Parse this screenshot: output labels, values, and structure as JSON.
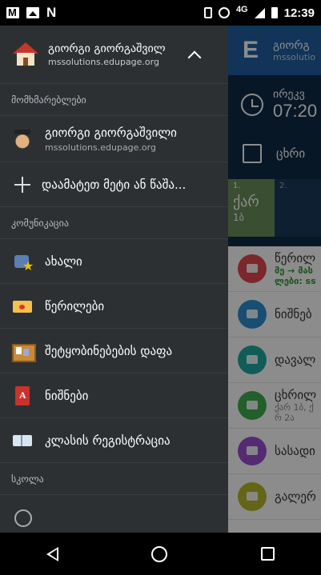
{
  "status_bar": {
    "network": "4G",
    "time": "12:39"
  },
  "background_app": {
    "header": {
      "logo": "E",
      "user_name": "გიორგ",
      "user_school": "mssolutio"
    },
    "time_label": "ირეკვ",
    "time_value": "07:20",
    "schedule_label": "ცხრი",
    "lessons": [
      {
        "number": "1.",
        "subject": "ქარ",
        "class": "1ბ"
      },
      {
        "number": "2.",
        "subject": "",
        "class": ""
      }
    ],
    "rows": [
      {
        "color": "#e2474f",
        "title": "წერილ",
        "sub1": "მე → მას",
        "sub2": "ლები: ss"
      },
      {
        "color": "#2d8fd0",
        "title": "ნიშნებ",
        "sub1": "",
        "sub2": ""
      },
      {
        "color": "#20a8a0",
        "title": "დავალ",
        "sub1": "",
        "sub2": ""
      },
      {
        "color": "#3fae4f",
        "title": "ცხრილ",
        "sub1": "ქარ 1ბ, ქ",
        "sub2": "რ 2ა"
      },
      {
        "color": "#9a4fd0",
        "title": "სასადი",
        "sub1": "",
        "sub2": ""
      },
      {
        "color": "#b6b82a",
        "title": "გალერ",
        "sub1": "",
        "sub2": ""
      }
    ]
  },
  "drawer": {
    "account": {
      "name": "გიორგი გიორგაშვილ",
      "school": "mssolutions.edupage.org"
    },
    "section_users": "მომხმარებლები",
    "user": {
      "name": "გიორგი გიორგაშვილი",
      "school": "mssolutions.edupage.org"
    },
    "add_more": "დაამატეთ მეტი ან წაშა...",
    "section_communication": "კომუნიკაცია",
    "items": [
      {
        "label": "ახალი",
        "icon": "new-icon"
      },
      {
        "label": "წერილები",
        "icon": "mail-icon"
      },
      {
        "label": "შეტყობინებების დაფა",
        "icon": "noticeboard-icon"
      },
      {
        "label": "ნიშნები",
        "icon": "grades-book-icon"
      },
      {
        "label": "კლასის რეგისტრაცია",
        "icon": "class-register-icon"
      }
    ],
    "section_school": "სკოლა"
  }
}
